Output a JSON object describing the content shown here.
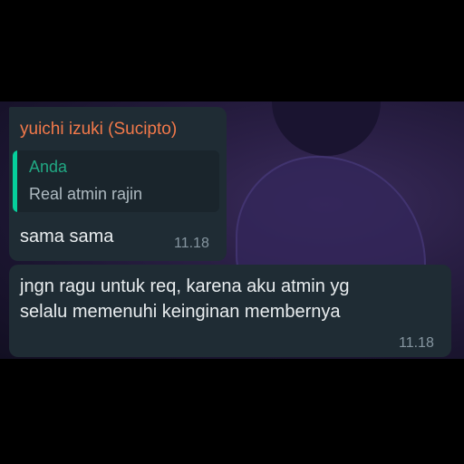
{
  "messages": [
    {
      "sender": "yuichi izuki (Sucipto)",
      "quoted": {
        "author": "Anda",
        "text": "Real atmin rajin"
      },
      "text": "sama sama",
      "time": "11.18"
    },
    {
      "text_line1": "jngn ragu untuk req, karena aku atmin yg",
      "text_line2": "selalu memenuhi keinginan membernya",
      "time": "11.18"
    }
  ],
  "colors": {
    "bubble": "#1f2c34",
    "sender": "#f2794a",
    "quote_accent": "#06cf9c",
    "timestamp": "#8696a0"
  }
}
